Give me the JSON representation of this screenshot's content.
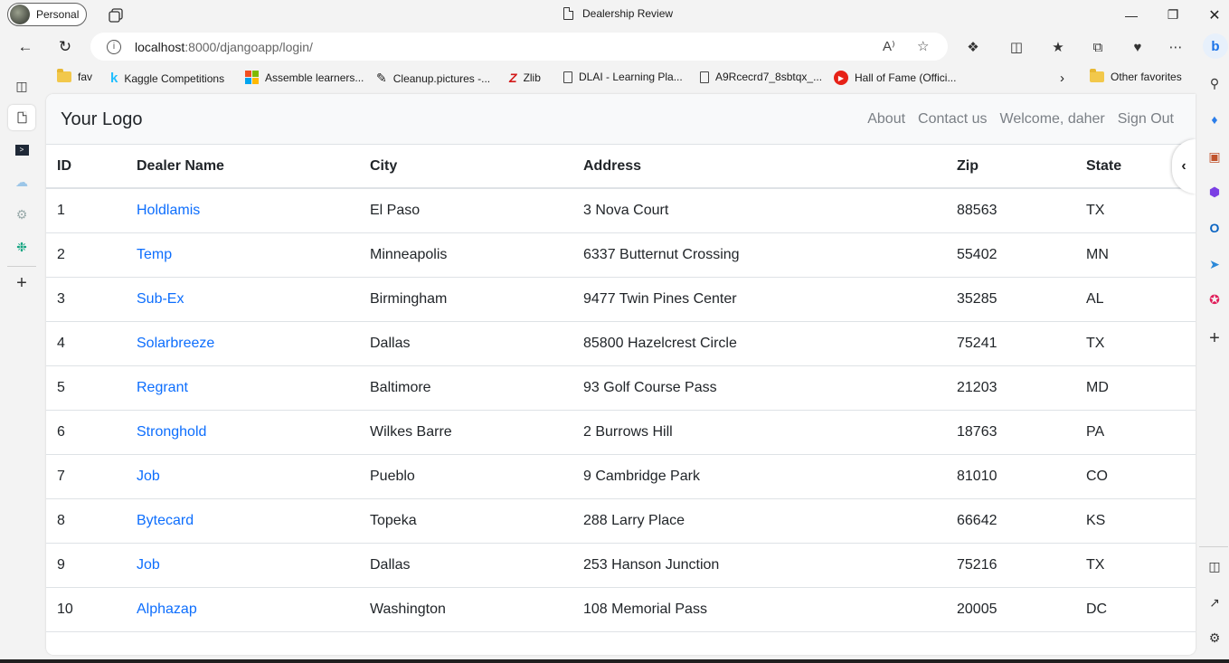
{
  "browser": {
    "profile_label": "Personal",
    "window_title": "Dealership Review",
    "url_host": "localhost",
    "url_path": ":8000/djangoapp/login/",
    "favorites": [
      {
        "label": "fav",
        "icon": "folder-icon"
      },
      {
        "label": "Kaggle Competitions",
        "icon": "kaggle-icon"
      },
      {
        "label": "Assemble learners...",
        "icon": "microsoft-icon"
      },
      {
        "label": "Cleanup.pictures -...",
        "icon": "cleanup-icon"
      },
      {
        "label": "Zlib",
        "icon": "zlib-icon"
      },
      {
        "label": "DLAI - Learning Pla...",
        "icon": "page-icon"
      },
      {
        "label": "A9Rcecrd7_8sbtqx_...",
        "icon": "page-icon"
      },
      {
        "label": "Hall of Fame (Offici...",
        "icon": "youtube-music-icon"
      }
    ],
    "other_favorites": "Other favorites",
    "colors": {
      "chrome_bg": "#f3f3f3",
      "link": "#0d6efd"
    }
  },
  "site": {
    "brand": "Your Logo",
    "nav": {
      "about": "About",
      "contact": "Contact us",
      "welcome": "Welcome, daher",
      "signout": "Sign Out"
    }
  },
  "table": {
    "headers": [
      "ID",
      "Dealer Name",
      "City",
      "Address",
      "Zip",
      "State"
    ],
    "rows": [
      [
        "1",
        "Holdlamis",
        "El Paso",
        "3 Nova Court",
        "88563",
        "TX"
      ],
      [
        "2",
        "Temp",
        "Minneapolis",
        "6337 Butternut Crossing",
        "55402",
        "MN"
      ],
      [
        "3",
        "Sub-Ex",
        "Birmingham",
        "9477 Twin Pines Center",
        "35285",
        "AL"
      ],
      [
        "4",
        "Solarbreeze",
        "Dallas",
        "85800 Hazelcrest Circle",
        "75241",
        "TX"
      ],
      [
        "5",
        "Regrant",
        "Baltimore",
        "93 Golf Course Pass",
        "21203",
        "MD"
      ],
      [
        "6",
        "Stronghold",
        "Wilkes Barre",
        "2 Burrows Hill",
        "18763",
        "PA"
      ],
      [
        "7",
        "Job",
        "Pueblo",
        "9 Cambridge Park",
        "81010",
        "CO"
      ],
      [
        "8",
        "Bytecard",
        "Topeka",
        "288 Larry Place",
        "66642",
        "KS"
      ],
      [
        "9",
        "Job",
        "Dallas",
        "253 Hanson Junction",
        "75216",
        "TX"
      ],
      [
        "10",
        "Alphazap",
        "Washington",
        "108 Memorial Pass",
        "20005",
        "DC"
      ]
    ]
  }
}
